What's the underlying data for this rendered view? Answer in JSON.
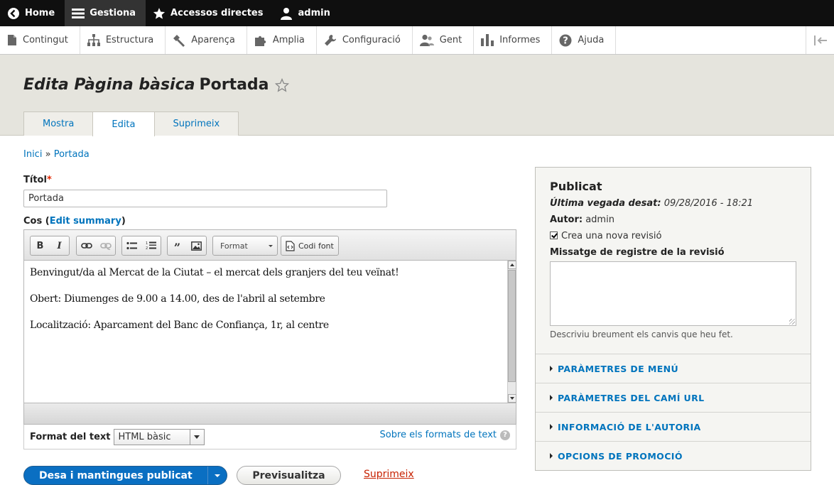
{
  "toolbar": {
    "items": [
      {
        "label": "Home",
        "icon": "back-arrow-icon"
      },
      {
        "label": "Gestiona",
        "icon": "menu-icon"
      },
      {
        "label": "Accessos directes",
        "icon": "star-icon"
      },
      {
        "label": "admin",
        "icon": "user-icon"
      }
    ]
  },
  "tray": {
    "items": [
      {
        "label": "Contingut",
        "icon": "file-icon"
      },
      {
        "label": "Estructura",
        "icon": "sitemap-icon"
      },
      {
        "label": "Aparença",
        "icon": "brush-icon"
      },
      {
        "label": "Amplia",
        "icon": "puzzle-icon"
      },
      {
        "label": "Configuració",
        "icon": "wrench-icon"
      },
      {
        "label": "Gent",
        "icon": "people-icon"
      },
      {
        "label": "Informes",
        "icon": "bar-chart-icon"
      },
      {
        "label": "Ajuda",
        "icon": "help-icon"
      }
    ]
  },
  "page": {
    "title_prefix": "Edita Pàgina bàsica",
    "title_name": "Portada",
    "tabs": [
      "Mostra",
      "Edita",
      "Suprimeix"
    ]
  },
  "breadcrumb": {
    "home": "Inici",
    "separator": "»",
    "current": "Portada"
  },
  "form": {
    "title_label": "Títol",
    "title_required": "*",
    "title_value": "Portada",
    "body_label": "Cos",
    "body_edit_summary": "Edit summary",
    "editor": {
      "format_label": "Format",
      "source_label": "Codi font",
      "paragraphs": [
        "Benvingut/da al Mercat de la Ciutat – el mercat dels granjers del teu veïnat!",
        "Obert: Diumenges de 9.00 a 14.00, des de l'abril al setembre",
        "Localització: Aparcament del Banc de Confiança, 1r, al centre"
      ]
    },
    "text_format_label": "Format del text",
    "text_format_value": "HTML bàsic",
    "text_format_help": "Sobre els formats de text"
  },
  "actions": {
    "save_label": "Desa i mantingues publicat",
    "preview_label": "Previsualitza",
    "delete_label": "Suprimeix"
  },
  "sidebar": {
    "title": "Publicat",
    "last_saved_label": "Última vegada desat:",
    "last_saved_value": "09/28/2016 - 18:21",
    "author_label": "Autor:",
    "author_value": "admin",
    "new_revision_label": "Crea una nova revisió",
    "revision_log_label": "Missatge de registre de la revisió",
    "revision_log_desc": "Descriviu breument els canvis que heu fet.",
    "sections": [
      "PARÀMETRES DE MENÚ",
      "PARÀMETRES DEL CAMÍ URL",
      "INFORMACIÓ DE L'AUTORIA",
      "OPCIONS DE PROMOCIÓ"
    ]
  },
  "colors": {
    "link": "#0074bd",
    "primary": "#0a6fc2",
    "danger": "#c72100",
    "header_bg": "#e5e4dd"
  }
}
